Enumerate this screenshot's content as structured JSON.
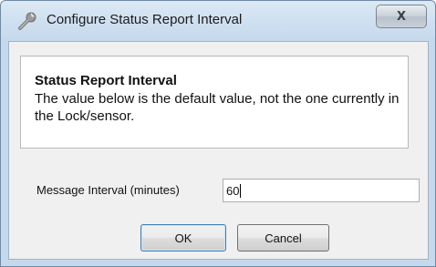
{
  "window": {
    "title": "Configure Status Report Interval",
    "close_label": "X"
  },
  "info": {
    "heading": "Status Report Interval",
    "body": "The value below is the default value, not the one currently in the Lock/sensor."
  },
  "form": {
    "interval_label": "Message Interval (minutes)",
    "interval_value": "60"
  },
  "buttons": {
    "ok_label": "OK",
    "cancel_label": "Cancel"
  },
  "icons": {
    "title": "wrench-icon",
    "close": "close-icon"
  }
}
